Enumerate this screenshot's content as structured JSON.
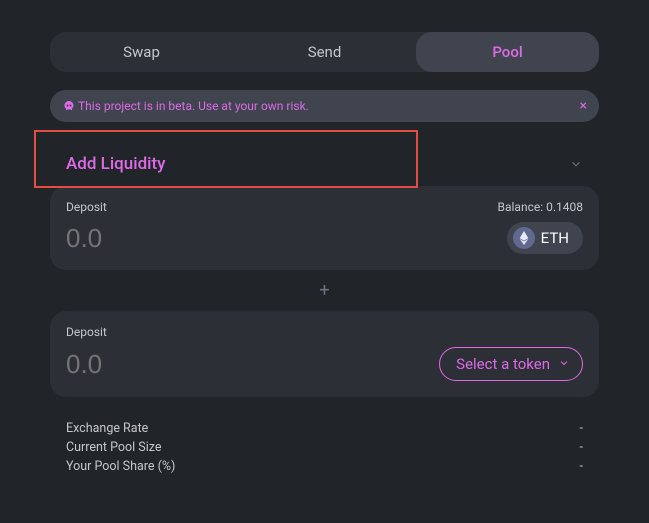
{
  "tabs": {
    "swap": "Swap",
    "send": "Send",
    "pool": "Pool"
  },
  "warning": {
    "text": "This project is in beta. Use at your own risk.",
    "close": "×"
  },
  "section": {
    "title": "Add Liquidity"
  },
  "deposit1": {
    "label": "Deposit",
    "balance_label": "Balance: 0.1408",
    "placeholder": "0.0",
    "token": "ETH"
  },
  "plus": "+",
  "deposit2": {
    "label": "Deposit",
    "placeholder": "0.0",
    "select_label": "Select a token"
  },
  "info": {
    "exchange_rate_label": "Exchange Rate",
    "exchange_rate_value": "-",
    "pool_size_label": "Current Pool Size",
    "pool_size_value": "-",
    "pool_share_label": "Your Pool Share (%)",
    "pool_share_value": "-"
  }
}
